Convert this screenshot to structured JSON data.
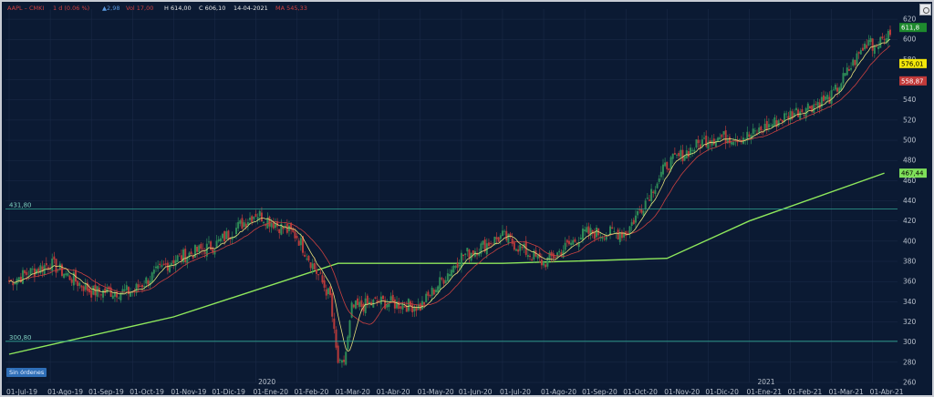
{
  "header": {
    "symbol": "AAPL – CMKI",
    "timeframe": "1 d (0.06 %)",
    "change": "2,98",
    "vol": "17,00",
    "high": "614,00",
    "close": "606,10",
    "date": "14-04-2021",
    "ma_value": "545,33"
  },
  "orders_badge": "Sin órdenes",
  "year_markers": [
    {
      "label": "2020",
      "x_index": 130
    },
    {
      "label": "2021",
      "x_index": 385
    }
  ],
  "horizontal_levels": [
    {
      "label": "431,80",
      "value": 431.8
    },
    {
      "label": "300,80",
      "value": 300.8
    }
  ],
  "price_badges": [
    {
      "label": "611,8",
      "value": 611.8,
      "color": "#1e8a2e",
      "text_color": "#ffffff"
    },
    {
      "label": "576,01",
      "value": 576.01,
      "color": "#f2e60a",
      "text_color": "#000000"
    },
    {
      "label": "558,87",
      "value": 558.87,
      "color": "#c23a3a",
      "text_color": "#ffffff"
    },
    {
      "label": "467,44",
      "value": 467.44,
      "color": "#7fe05a",
      "text_color": "#000000"
    }
  ],
  "colors": {
    "background": "#0b1a33",
    "grid": "#1d2d4a",
    "up_candle": "#2e8b57",
    "down_candle": "#b83a3a",
    "ma_fast": "#e6e07a",
    "ma_mid": "#c94040",
    "ma_slow": "#8ee85c",
    "level_line": "#2fa592"
  },
  "chart_data": {
    "type": "candlestick",
    "title": "",
    "ylim": [
      260,
      630
    ],
    "y_ticks": [
      260,
      280,
      300,
      320,
      340,
      360,
      380,
      400,
      420,
      440,
      460,
      480,
      500,
      520,
      540,
      560,
      580,
      600,
      620
    ],
    "x_tick_labels": [
      "01-Jul-19",
      "01-Ago-19",
      "01-Sep-19",
      "01-Oct-19",
      "01-Nov-19",
      "01-Dic-19",
      "01-Ene-20",
      "01-Feb-20",
      "01-Mar-20",
      "01-Abr-20",
      "01-May-20",
      "01-Jun-20",
      "01-Jul-20",
      "01-Ago-20",
      "01-Sep-20",
      "01-Oct-20",
      "01-Nov-20",
      "01-Dic-20",
      "01-Ene-21",
      "01-Feb-21",
      "01-Mar-21",
      "01-Abr-21"
    ],
    "anchors": [
      {
        "label": "01-Jul-19",
        "close": 360
      },
      {
        "label": "01-Ago-19",
        "close": 378
      },
      {
        "label": "01-Sep-19",
        "close": 350
      },
      {
        "label": "01-Oct-19",
        "close": 350
      },
      {
        "label": "01-Nov-19",
        "close": 382
      },
      {
        "label": "01-Dic-19",
        "close": 396
      },
      {
        "label": "01-Ene-20",
        "close": 428
      },
      {
        "label": "01-Feb-20",
        "close": 405
      },
      {
        "label": "01-Mar-20",
        "close": 330
      },
      {
        "label": "01-Abr-20",
        "close": 340
      },
      {
        "label": "01-May-20",
        "close": 335
      },
      {
        "label": "01-Jun-20",
        "close": 385
      },
      {
        "label": "01-Jul-20",
        "close": 405
      },
      {
        "label": "01-Ago-20",
        "close": 378
      },
      {
        "label": "01-Sep-20",
        "close": 408
      },
      {
        "label": "01-Oct-20",
        "close": 408
      },
      {
        "label": "01-Nov-20",
        "close": 476
      },
      {
        "label": "01-Dic-20",
        "close": 502
      },
      {
        "label": "01-Ene-21",
        "close": 504
      },
      {
        "label": "01-Feb-21",
        "close": 526
      },
      {
        "label": "01-Mar-21",
        "close": 543
      },
      {
        "label": "01-Abr-21",
        "close": 606
      }
    ],
    "sma200_anchors": [
      {
        "label": "01-Jul-19",
        "value": 288
      },
      {
        "label": "01-Nov-19",
        "value": 325
      },
      {
        "label": "01-Mar-20",
        "value": 378
      },
      {
        "label": "01-Jul-20",
        "value": 378
      },
      {
        "label": "01-Nov-20",
        "value": 383
      },
      {
        "label": "01-Ene-21",
        "value": 420
      },
      {
        "label": "01-Abr-21",
        "value": 467.44
      }
    ]
  }
}
